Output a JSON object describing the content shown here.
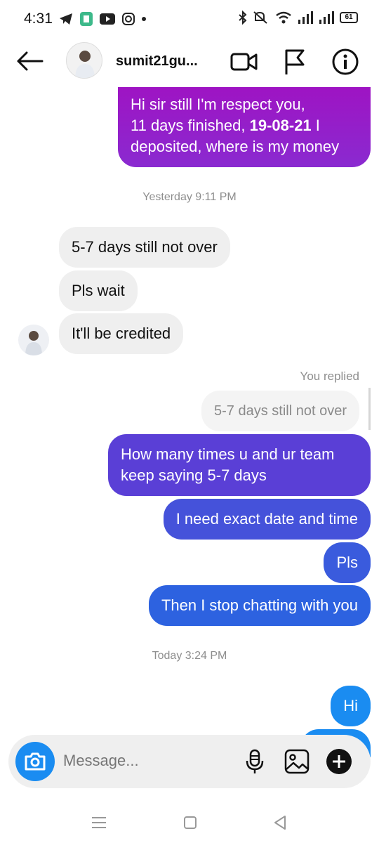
{
  "status_bar": {
    "time": "4:31",
    "battery": "61"
  },
  "header": {
    "contact_name": "sumit21gu..."
  },
  "messages": [
    {
      "side": "sent",
      "lines": [
        {
          "text": "Hi sir still I'm respect you,"
        },
        {
          "pre": "11 days finished, ",
          "bold": "19-08-21",
          "post": " I"
        },
        {
          "text": "deposited, where is my money"
        }
      ]
    }
  ],
  "timestamps": {
    "yesterday": "Yesterday 9:11 PM",
    "today": "Today 3:24 PM"
  },
  "received": [
    {
      "text": "5-7 days still not over"
    },
    {
      "text": "Pls wait"
    },
    {
      "text": "It'll be credited"
    }
  ],
  "reply": {
    "label": "You replied",
    "quoted": "5-7 days still not over"
  },
  "sent_messages": [
    {
      "lines": [
        "How many times u and ur team",
        "keep saying 5-7 days"
      ]
    },
    {
      "lines": [
        "I need exact date and time"
      ]
    },
    {
      "lines": [
        "Pls"
      ]
    },
    {
      "lines": [
        "Then I stop chatting with you"
      ]
    },
    {
      "lines": [
        "Hi"
      ]
    }
  ],
  "composer": {
    "placeholder": "Message..."
  },
  "colors": {
    "purple_bubble": "#9b19c6",
    "violet_bubble": "#5a3fd6",
    "blue_bubble": "#2d58e0",
    "brand_blue": "#1a8cf1"
  },
  "icons": [
    "back-arrow-icon",
    "video-call-icon",
    "flag-icon",
    "info-icon",
    "camera-icon",
    "microphone-icon",
    "gallery-icon",
    "plus-icon"
  ]
}
